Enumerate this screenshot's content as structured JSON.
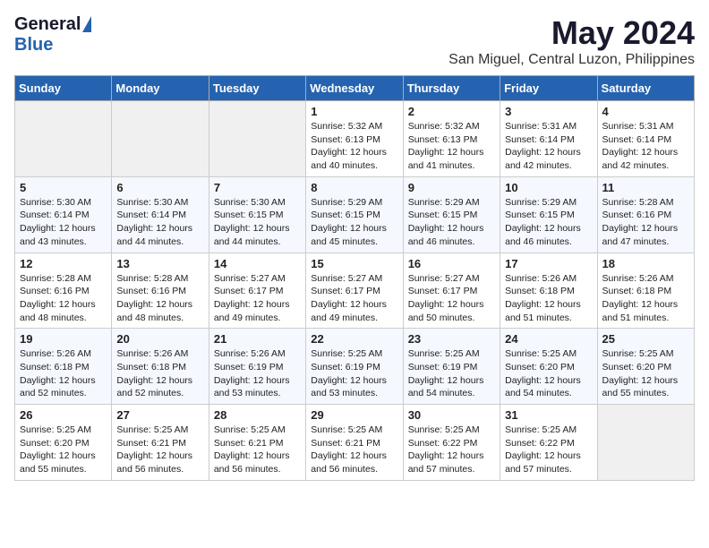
{
  "logo": {
    "general": "General",
    "blue": "Blue"
  },
  "title": {
    "month_year": "May 2024",
    "location": "San Miguel, Central Luzon, Philippines"
  },
  "days_of_week": [
    "Sunday",
    "Monday",
    "Tuesday",
    "Wednesday",
    "Thursday",
    "Friday",
    "Saturday"
  ],
  "weeks": [
    [
      {
        "day": "",
        "info": ""
      },
      {
        "day": "",
        "info": ""
      },
      {
        "day": "",
        "info": ""
      },
      {
        "day": "1",
        "info": "Sunrise: 5:32 AM\nSunset: 6:13 PM\nDaylight: 12 hours\nand 40 minutes."
      },
      {
        "day": "2",
        "info": "Sunrise: 5:32 AM\nSunset: 6:13 PM\nDaylight: 12 hours\nand 41 minutes."
      },
      {
        "day": "3",
        "info": "Sunrise: 5:31 AM\nSunset: 6:14 PM\nDaylight: 12 hours\nand 42 minutes."
      },
      {
        "day": "4",
        "info": "Sunrise: 5:31 AM\nSunset: 6:14 PM\nDaylight: 12 hours\nand 42 minutes."
      }
    ],
    [
      {
        "day": "5",
        "info": "Sunrise: 5:30 AM\nSunset: 6:14 PM\nDaylight: 12 hours\nand 43 minutes."
      },
      {
        "day": "6",
        "info": "Sunrise: 5:30 AM\nSunset: 6:14 PM\nDaylight: 12 hours\nand 44 minutes."
      },
      {
        "day": "7",
        "info": "Sunrise: 5:30 AM\nSunset: 6:15 PM\nDaylight: 12 hours\nand 44 minutes."
      },
      {
        "day": "8",
        "info": "Sunrise: 5:29 AM\nSunset: 6:15 PM\nDaylight: 12 hours\nand 45 minutes."
      },
      {
        "day": "9",
        "info": "Sunrise: 5:29 AM\nSunset: 6:15 PM\nDaylight: 12 hours\nand 46 minutes."
      },
      {
        "day": "10",
        "info": "Sunrise: 5:29 AM\nSunset: 6:15 PM\nDaylight: 12 hours\nand 46 minutes."
      },
      {
        "day": "11",
        "info": "Sunrise: 5:28 AM\nSunset: 6:16 PM\nDaylight: 12 hours\nand 47 minutes."
      }
    ],
    [
      {
        "day": "12",
        "info": "Sunrise: 5:28 AM\nSunset: 6:16 PM\nDaylight: 12 hours\nand 48 minutes."
      },
      {
        "day": "13",
        "info": "Sunrise: 5:28 AM\nSunset: 6:16 PM\nDaylight: 12 hours\nand 48 minutes."
      },
      {
        "day": "14",
        "info": "Sunrise: 5:27 AM\nSunset: 6:17 PM\nDaylight: 12 hours\nand 49 minutes."
      },
      {
        "day": "15",
        "info": "Sunrise: 5:27 AM\nSunset: 6:17 PM\nDaylight: 12 hours\nand 49 minutes."
      },
      {
        "day": "16",
        "info": "Sunrise: 5:27 AM\nSunset: 6:17 PM\nDaylight: 12 hours\nand 50 minutes."
      },
      {
        "day": "17",
        "info": "Sunrise: 5:26 AM\nSunset: 6:18 PM\nDaylight: 12 hours\nand 51 minutes."
      },
      {
        "day": "18",
        "info": "Sunrise: 5:26 AM\nSunset: 6:18 PM\nDaylight: 12 hours\nand 51 minutes."
      }
    ],
    [
      {
        "day": "19",
        "info": "Sunrise: 5:26 AM\nSunset: 6:18 PM\nDaylight: 12 hours\nand 52 minutes."
      },
      {
        "day": "20",
        "info": "Sunrise: 5:26 AM\nSunset: 6:18 PM\nDaylight: 12 hours\nand 52 minutes."
      },
      {
        "day": "21",
        "info": "Sunrise: 5:26 AM\nSunset: 6:19 PM\nDaylight: 12 hours\nand 53 minutes."
      },
      {
        "day": "22",
        "info": "Sunrise: 5:25 AM\nSunset: 6:19 PM\nDaylight: 12 hours\nand 53 minutes."
      },
      {
        "day": "23",
        "info": "Sunrise: 5:25 AM\nSunset: 6:19 PM\nDaylight: 12 hours\nand 54 minutes."
      },
      {
        "day": "24",
        "info": "Sunrise: 5:25 AM\nSunset: 6:20 PM\nDaylight: 12 hours\nand 54 minutes."
      },
      {
        "day": "25",
        "info": "Sunrise: 5:25 AM\nSunset: 6:20 PM\nDaylight: 12 hours\nand 55 minutes."
      }
    ],
    [
      {
        "day": "26",
        "info": "Sunrise: 5:25 AM\nSunset: 6:20 PM\nDaylight: 12 hours\nand 55 minutes."
      },
      {
        "day": "27",
        "info": "Sunrise: 5:25 AM\nSunset: 6:21 PM\nDaylight: 12 hours\nand 56 minutes."
      },
      {
        "day": "28",
        "info": "Sunrise: 5:25 AM\nSunset: 6:21 PM\nDaylight: 12 hours\nand 56 minutes."
      },
      {
        "day": "29",
        "info": "Sunrise: 5:25 AM\nSunset: 6:21 PM\nDaylight: 12 hours\nand 56 minutes."
      },
      {
        "day": "30",
        "info": "Sunrise: 5:25 AM\nSunset: 6:22 PM\nDaylight: 12 hours\nand 57 minutes."
      },
      {
        "day": "31",
        "info": "Sunrise: 5:25 AM\nSunset: 6:22 PM\nDaylight: 12 hours\nand 57 minutes."
      },
      {
        "day": "",
        "info": ""
      }
    ]
  ]
}
